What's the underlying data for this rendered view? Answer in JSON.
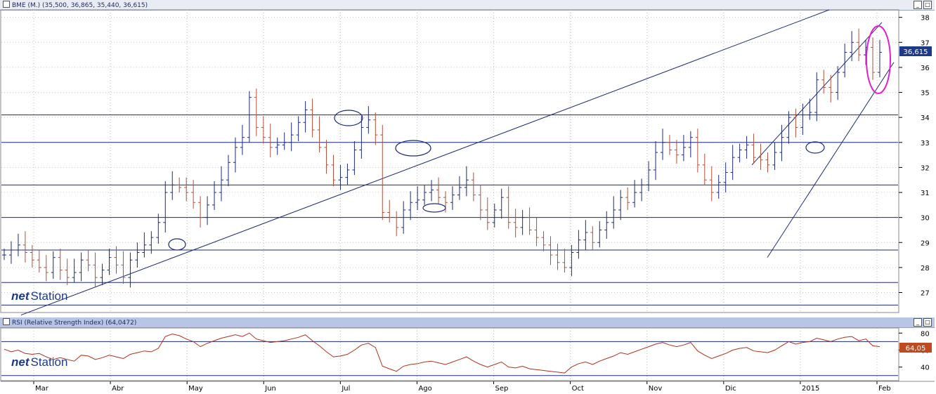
{
  "main_panel": {
    "title": "BME (M.) (35,500, 36,865, 35,440, 36,615)",
    "last_price_label": "36,615",
    "logo_net": "net",
    "logo_station": "Station",
    "buttons": {
      "minimize": "_",
      "close": "□"
    }
  },
  "rsi_panel": {
    "title": "RSI (Relative Strength Index) (64,0472)",
    "last_value_label": "64,05",
    "logo_net": "net",
    "logo_station": "Station",
    "buttons": {
      "minimize": "_",
      "close": "□"
    }
  },
  "colors": {
    "up_bar": "#1c2a7a",
    "down_bar": "#b0503a",
    "line": "#1c2a7a",
    "highlight": "#e020d0",
    "rsi_line": "#b0301a",
    "label_bg_price": "#1c3a8a",
    "label_bg_rsi": "#c04a20"
  },
  "chart_data": [
    {
      "type": "ohlc",
      "ylim": [
        26.2,
        38.3
      ],
      "y_ticks": [
        27,
        28,
        29,
        30,
        31,
        32,
        33,
        34,
        35,
        36,
        37,
        38
      ],
      "x_labels": [
        "Mar",
        "Abr",
        "May",
        "Jun",
        "Jul",
        "Ago",
        "Sep",
        "Oct",
        "Nov",
        "Dic",
        "2015",
        "Feb"
      ],
      "horizontal_levels": [
        34.1,
        33.0,
        31.3,
        30.0,
        28.7,
        27.4,
        26.5
      ],
      "close_series": [
        28.5,
        28.7,
        28.9,
        28.6,
        28.3,
        28.0,
        27.8,
        28.4,
        27.9,
        27.6,
        27.8,
        28.3,
        28.1,
        27.6,
        27.9,
        28.4,
        28.1,
        27.6,
        28.3,
        28.6,
        28.9,
        29.2,
        29.8,
        31.0,
        31.3,
        31.2,
        31.0,
        30.6,
        30.0,
        30.5,
        31.0,
        31.5,
        32.2,
        32.8,
        33.2,
        34.8,
        33.6,
        33.2,
        32.8,
        32.9,
        33.0,
        33.3,
        33.8,
        34.3,
        33.5,
        32.8,
        32.1,
        31.5,
        31.6,
        31.9,
        32.7,
        33.6,
        33.9,
        33.3,
        30.2,
        30.0,
        29.6,
        30.3,
        30.6,
        30.7,
        31.0,
        31.1,
        30.8,
        30.6,
        30.9,
        31.2,
        31.5,
        30.9,
        30.3,
        29.8,
        30.3,
        30.8,
        29.8,
        29.6,
        30.0,
        29.5,
        29.2,
        28.9,
        28.5,
        28.2,
        28.0,
        28.6,
        29.1,
        29.4,
        29.0,
        29.5,
        29.8,
        30.3,
        30.8,
        30.6,
        31.0,
        31.3,
        31.9,
        32.6,
        33.0,
        32.7,
        32.5,
        32.8,
        33.2,
        32.1,
        31.5,
        31.0,
        31.4,
        31.8,
        32.4,
        32.7,
        32.9,
        32.4,
        32.3,
        32.1,
        32.6,
        33.2,
        34.0,
        33.6,
        34.1,
        34.2,
        35.5,
        35.2,
        35.0,
        35.8,
        36.6,
        37.0,
        36.5,
        36.8,
        35.8,
        36.6
      ]
    },
    {
      "type": "line",
      "name": "RSI",
      "ylim": [
        24,
        86
      ],
      "y_ticks": [
        40,
        60,
        80
      ],
      "reference_levels": [
        70,
        30
      ],
      "values": [
        61,
        58,
        60,
        56,
        55,
        56,
        52,
        49,
        51,
        49,
        47,
        54,
        53,
        49,
        51,
        54,
        52,
        50,
        55,
        57,
        59,
        58,
        62,
        76,
        79,
        77,
        73,
        70,
        64,
        68,
        71,
        74,
        76,
        78,
        76,
        80,
        73,
        71,
        69,
        70,
        71,
        73,
        75,
        78,
        71,
        65,
        58,
        52,
        53,
        55,
        60,
        66,
        68,
        63,
        41,
        38,
        35,
        41,
        43,
        44,
        46,
        47,
        45,
        43,
        46,
        49,
        52,
        47,
        43,
        40,
        43,
        46,
        40,
        39,
        41,
        38,
        37,
        36,
        35,
        34,
        33,
        40,
        44,
        46,
        43,
        47,
        50,
        53,
        57,
        55,
        58,
        61,
        64,
        67,
        69,
        66,
        64,
        66,
        69,
        59,
        54,
        50,
        53,
        56,
        60,
        62,
        63,
        59,
        58,
        57,
        60,
        65,
        70,
        67,
        69,
        70,
        74,
        72,
        70,
        73,
        75,
        76,
        71,
        73,
        65,
        64
      ]
    }
  ]
}
